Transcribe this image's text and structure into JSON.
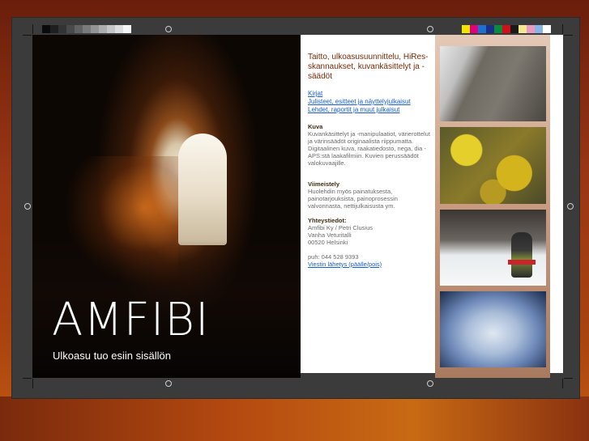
{
  "brand": {
    "name": "AMFIBI",
    "tagline": "Ulkoasu tuo esiin sisällön"
  },
  "services_heading": "Taitto, ulkoasusuunnittelu, HiRes-skannaukset, kuvankäsittelyt ja -säädöt",
  "links": [
    "Kirjat",
    "Julisteet, esitteet ja näyttelyjulkaisut",
    "Lehdet, raportit ja muut julkaisut"
  ],
  "sections": {
    "kuva": {
      "title": "Kuva",
      "body": "Kuvankäsittelyt ja -manipulaatiot, värierottelut ja värinsäädöt originaalista riippumatta. Digitaalinen kuva, raakatiedosto, nega, dia - APS:stä laakafilmiin. Kuvien perussäädöt valokuvaajille."
    },
    "viimeistely": {
      "title": "Viimeistely",
      "body": "Huolehdin myös painatuksesta, painotarjouksista, painoprosessin valvonnasta, nettijulkaisusta ym."
    },
    "contact": {
      "title": "Yhteystiedot:",
      "lines": [
        "Amfibi Ky / Petri Clusius",
        "Vanha Veturitalli",
        "00520 Helsinki"
      ],
      "phone": "puh: 044 528 9393",
      "toggle_link": "Viestin lähetys (päälle/pois)"
    }
  },
  "grayscale_swatches": [
    "#0a0a0a",
    "#1f1f1f",
    "#333333",
    "#4a4a4a",
    "#626262",
    "#7a7a7a",
    "#949494",
    "#adadad",
    "#c6c6c6",
    "#dedede",
    "#f5f5f5"
  ],
  "color_swatches": [
    "#f2e600",
    "#e2007a",
    "#1d6fd1",
    "#1a2f8a",
    "#0a8a3a",
    "#d1101a",
    "#1a1a1a",
    "#f2e890",
    "#e89ac0",
    "#8ab4e8",
    "#ffffff"
  ]
}
